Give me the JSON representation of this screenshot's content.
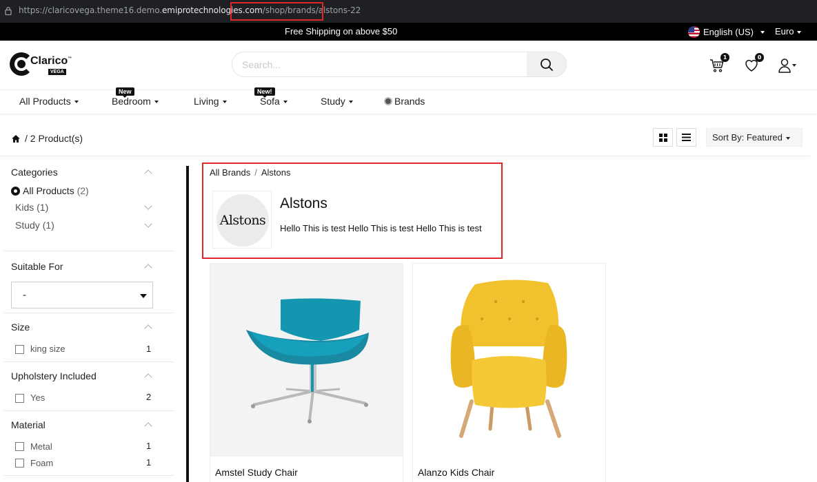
{
  "browser": {
    "url_protocol": "https://",
    "url_host_prefix": "claricovega.theme16.demo.",
    "url_host_main": "emiprotechnologies.com",
    "url_path": "/shop/brands/alstons-22"
  },
  "promo": {
    "message": "Free Shipping on above $50",
    "language": "English (US)",
    "currency": "Euro"
  },
  "header": {
    "logo_word": "Clarico",
    "logo_tm": "™",
    "logo_sub": "VEGA",
    "search_placeholder": "Search...",
    "cart_count": "1",
    "wishlist_count": "0"
  },
  "nav": {
    "items": [
      {
        "label": "All Products"
      },
      {
        "label": "Bedroom",
        "tag": "New"
      },
      {
        "label": "Living"
      },
      {
        "label": "Sofa",
        "tag": "New!"
      },
      {
        "label": "Study"
      },
      {
        "label": "Brands"
      }
    ]
  },
  "toolbar": {
    "product_count": "/ 2 Product(s)",
    "sort_label": "Sort By: Featured"
  },
  "sidebar": {
    "categories": {
      "title": "Categories",
      "items": [
        {
          "label": "All Products",
          "count": "(2)"
        },
        {
          "label": "Kids",
          "count": "(1)"
        },
        {
          "label": "Study",
          "count": "(1)"
        }
      ]
    },
    "suitable": {
      "title": "Suitable For",
      "selected": "-"
    },
    "size": {
      "title": "Size",
      "options": [
        {
          "label": "king size",
          "count": "1"
        }
      ]
    },
    "upholstery": {
      "title": "Upholstery Included",
      "options": [
        {
          "label": "Yes",
          "count": "2"
        }
      ]
    },
    "material": {
      "title": "Material",
      "options": [
        {
          "label": "Metal",
          "count": "1"
        },
        {
          "label": "Foam",
          "count": "1"
        }
      ]
    }
  },
  "brand": {
    "breadcrumb_root": "All Brands",
    "breadcrumb_sep": "/",
    "breadcrumb_current": "Alstons",
    "logo_text": "Alstons",
    "name": "Alstons",
    "description": "Hello This is test Hello This is test Hello This is test"
  },
  "products": [
    {
      "name": "Amstel Study Chair",
      "color": "#1596b0"
    },
    {
      "name": "Alanzo Kids Chair",
      "color": "#f2c12e"
    }
  ],
  "colors": {
    "highlight": "#e0252b",
    "dark": "#111111"
  }
}
